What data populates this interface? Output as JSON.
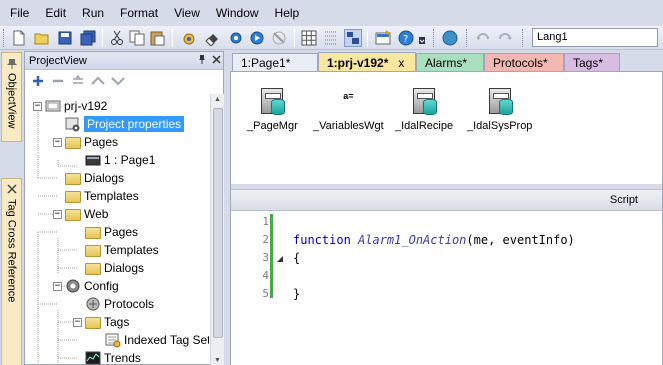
{
  "menu": [
    "File",
    "Edit",
    "Run",
    "Format",
    "View",
    "Window",
    "Help"
  ],
  "toolbar": {
    "language_value": "Lang1"
  },
  "side_tabs": [
    "ObjectView",
    "Tag Cross Reference"
  ],
  "project_view": {
    "title": "ProjectView",
    "tree": [
      {
        "label": "prj-v192"
      },
      {
        "label": "Project properties",
        "selected": true
      },
      {
        "label": "Pages"
      },
      {
        "label": "1 : Page1"
      },
      {
        "label": "Dialogs"
      },
      {
        "label": "Templates"
      },
      {
        "label": "Web"
      },
      {
        "label": "Pages"
      },
      {
        "label": "Templates"
      },
      {
        "label": "Dialogs"
      },
      {
        "label": "Config"
      },
      {
        "label": "Protocols"
      },
      {
        "label": "Tags"
      },
      {
        "label": "Indexed Tag Set"
      },
      {
        "label": "Trends"
      }
    ]
  },
  "doc_tabs": [
    {
      "label": "1:Page1*",
      "color": "#dde3f0"
    },
    {
      "label": "1:prj-v192*",
      "color": "#f9e79f",
      "active": true,
      "close": "x"
    },
    {
      "label": "Alarms*",
      "color": "#a9dfbf"
    },
    {
      "label": "Protocols*",
      "color": "#f5b7b1"
    },
    {
      "label": "Tags*",
      "color": "#d7bde2"
    }
  ],
  "widgets": [
    {
      "label": "_PageMgr",
      "icon": "database-icon"
    },
    {
      "label": "_VariablesWgt",
      "icon": "variable-icon",
      "glyph": "a="
    },
    {
      "label": "_IdalRecipe",
      "icon": "database-icon"
    },
    {
      "label": "_IdalSysProp",
      "icon": "database-icon"
    }
  ],
  "script": {
    "header": "Script",
    "line_numbers": [
      "1",
      "2",
      "3",
      "4",
      "5"
    ],
    "code": {
      "keyword": "function",
      "name": "Alarm1_OnAction",
      "params": "(me, eventInfo)",
      "open": "{",
      "close": "}"
    }
  }
}
